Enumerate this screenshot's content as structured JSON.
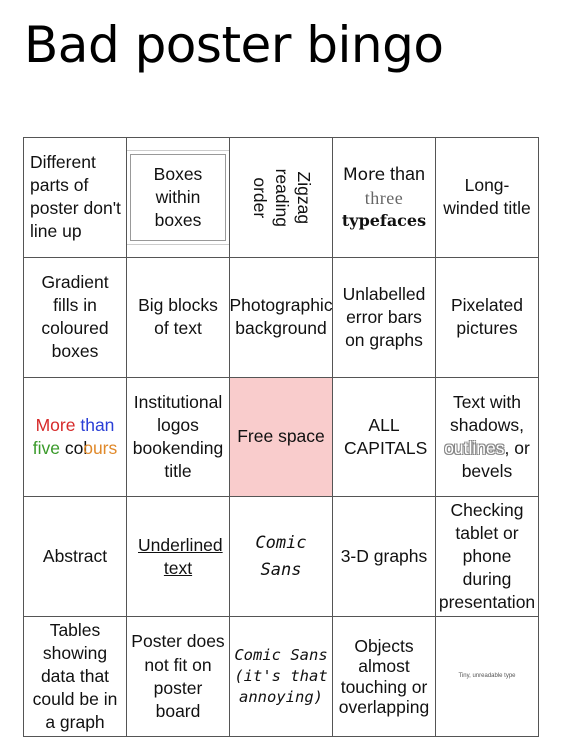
{
  "title": "Bad poster bingo",
  "cells": {
    "r1c1": "Different parts of poster don't line up",
    "r1c2": "Boxes within boxes",
    "r1c3": "Zigzag reading order",
    "r1c4_a": "More",
    "r1c4_b": "than",
    "r1c4_c": "three",
    "r1c4_d": "typefaces",
    "r1c5": "Long-winded title",
    "r2c1": "Gradient fills in coloured boxes",
    "r2c2": "Big blocks of text",
    "r2c3": "Photographic background",
    "r2c4": "Unlabelled error bars on graphs",
    "r2c5": "Pixelated pictures",
    "r3c1_more": "More",
    "r3c1_than": "than",
    "r3c1_five": "five",
    "r3c1_co": "col",
    "r3c1_ours": "ours",
    "r3c2": "Institutional logos bookending title",
    "r3c3": "Free space",
    "r3c4": "ALL CAPITALS",
    "r3c5_a": "Text with shadows,",
    "r3c5_b": "outlines",
    "r3c5_c": ", or bevels",
    "r4c1": "Abstract",
    "r4c2": "Underlined text",
    "r4c3": "Comic Sans",
    "r4c4": "3-D graphs",
    "r4c5": "Checking tablet or phone during presentation",
    "r5c1": "Tables showing data that could be in a graph",
    "r5c2": "Poster does not fit on poster board",
    "r5c3": "Comic Sans (it's that annoying)",
    "r5c4": "Objects almost touching or overlapping",
    "r5c5": "Tiny, unreadable type"
  },
  "colors": {
    "free_space_bg": "#f9cccc",
    "red": "#d62a2a",
    "blue": "#2a3fd6",
    "green": "#3a9a2a",
    "orange": "#e0892a"
  }
}
